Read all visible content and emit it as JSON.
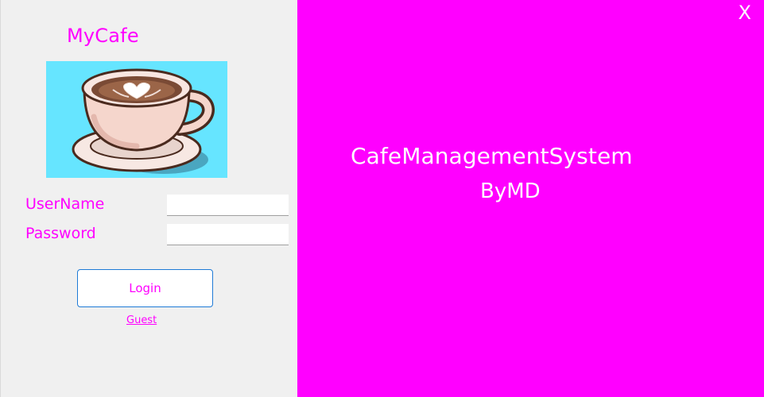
{
  "colors": {
    "accent": "#ff00ff",
    "right_panel_bg": "#ff00ff",
    "left_panel_bg": "#f0f0f0",
    "right_panel_text": "#ffffff"
  },
  "left_panel": {
    "title": "MyCafe",
    "logo_icon": "coffee-cup-icon",
    "username_label": "UserName",
    "username_value": "",
    "password_label": "Password",
    "password_value": "",
    "login_label": "Login",
    "guest_label": "Guest"
  },
  "right_panel": {
    "title": "CafeManagementSystem",
    "byline": "ByMD",
    "close_label": "X"
  }
}
